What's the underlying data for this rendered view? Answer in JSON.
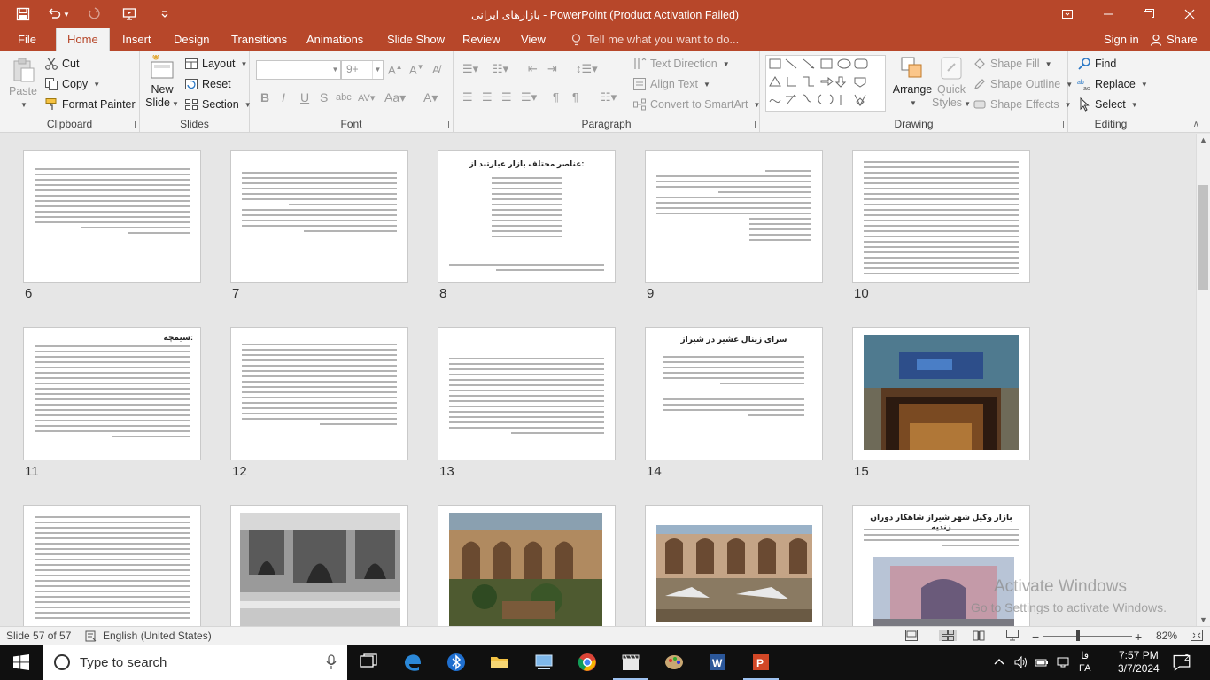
{
  "app": {
    "window_title": "بازارهای ایرانی - PowerPoint (Product Activation Failed)"
  },
  "tabs": [
    {
      "label": "File"
    },
    {
      "label": "Home"
    },
    {
      "label": "Insert"
    },
    {
      "label": "Design"
    },
    {
      "label": "Transitions"
    },
    {
      "label": "Animations"
    },
    {
      "label": "Slide Show"
    },
    {
      "label": "Review"
    },
    {
      "label": "View"
    }
  ],
  "tell_me_placeholder": "Tell me what you want to do...",
  "account": {
    "signin": "Sign in",
    "share": "Share"
  },
  "ribbon": {
    "clipboard": {
      "paste": "Paste",
      "cut": "Cut",
      "copy": "Copy",
      "format_painter": "Format Painter",
      "label": "Clipboard"
    },
    "slides": {
      "new_slide_1": "New",
      "new_slide_2": "Slide",
      "layout": "Layout",
      "reset": "Reset",
      "section": "Section",
      "label": "Slides"
    },
    "font": {
      "font_size": "9+",
      "label": "Font"
    },
    "paragraph": {
      "text_direction": "Text Direction",
      "align_text": "Align Text",
      "smartart": "Convert to SmartArt",
      "label": "Paragraph"
    },
    "drawing": {
      "arrange": "Arrange",
      "quick_styles_1": "Quick",
      "quick_styles_2": "Styles",
      "shape_fill": "Shape Fill",
      "shape_outline": "Shape Outline",
      "shape_effects": "Shape Effects",
      "label": "Drawing"
    },
    "editing": {
      "find": "Find",
      "replace": "Replace",
      "select": "Select",
      "label": "Editing"
    }
  },
  "slides": [
    {
      "num": "6"
    },
    {
      "num": "7"
    },
    {
      "num": "8",
      "heading": "عناصر مختلف بازار عبارتند از:"
    },
    {
      "num": "9"
    },
    {
      "num": "10"
    },
    {
      "num": "11",
      "heading": "سیمچه:"
    },
    {
      "num": "12"
    },
    {
      "num": "13"
    },
    {
      "num": "14",
      "heading": "سرای زینال عشیر در شیراز"
    },
    {
      "num": "15"
    },
    {
      "num": ""
    },
    {
      "num": ""
    },
    {
      "num": ""
    },
    {
      "num": ""
    },
    {
      "num": "",
      "heading": "بازار وکیل شهر شیراز شاهکار دوران زندیه"
    }
  ],
  "status": {
    "slide_info": "Slide 57 of 57",
    "language": "English (United States)",
    "zoom": "82%",
    "zoom_level": 0.82
  },
  "watermark": {
    "line1": "Activate Windows",
    "line2": "Go to Settings to activate Windows."
  },
  "taskbar": {
    "search_placeholder": "Type to search",
    "lang": "FA",
    "lang_sub": "فا",
    "time": "7:57 PM",
    "date": "3/7/2024",
    "notifications": "2"
  },
  "colors": {
    "accent": "#b7472a",
    "ribbon_bg": "#f3f3f3",
    "taskbar_bg": "#101010"
  }
}
